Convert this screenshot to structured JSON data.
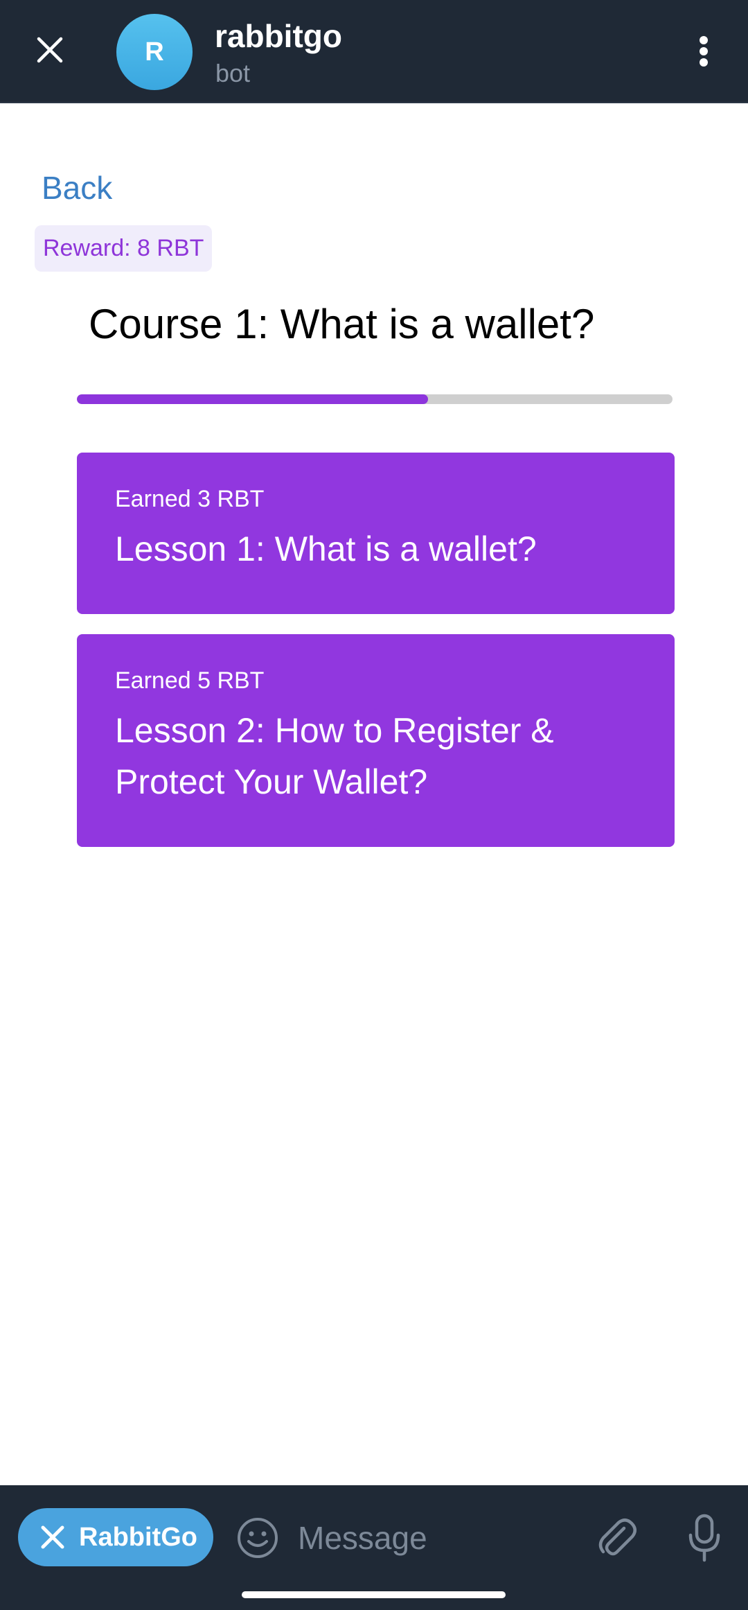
{
  "header": {
    "avatar_letter": "R",
    "title": "rabbitgo",
    "subtitle": "bot",
    "bg_color": "#1f2936"
  },
  "page": {
    "back_label": "Back",
    "reward_label": "Reward: 8 RBT",
    "course_title": "Course 1: What is a wallet?",
    "progress_fraction": 0.59,
    "accent_color": "#9137df"
  },
  "lessons": [
    {
      "earned": "Earned 3 RBT",
      "title": "Lesson 1: What is a wallet?"
    },
    {
      "earned": "Earned 5 RBT",
      "title": "Lesson 2: How to Register & Protect Your Wallet?"
    }
  ],
  "footer": {
    "bot_button_label": "RabbitGo",
    "message_placeholder": "Message",
    "icons": [
      "close-icon",
      "smile-icon",
      "paperclip-icon",
      "microphone-icon"
    ]
  }
}
